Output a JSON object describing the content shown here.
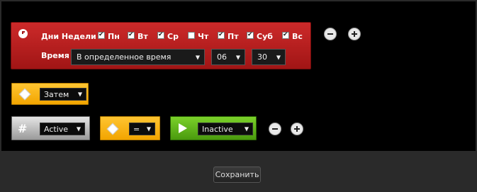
{
  "schedule": {
    "days_label": "Дни Недели",
    "days": [
      {
        "label": "Пн",
        "checked": true
      },
      {
        "label": "Вт",
        "checked": true
      },
      {
        "label": "Ср",
        "checked": true
      },
      {
        "label": "Чт",
        "checked": false
      },
      {
        "label": "Пт",
        "checked": true
      },
      {
        "label": "Суб",
        "checked": true
      },
      {
        "label": "Вс",
        "checked": true
      }
    ],
    "time_label": "Время",
    "time_mode": "В определенное время",
    "hour": "06",
    "minute": "30"
  },
  "then_block": {
    "value": "Затем"
  },
  "condition": {
    "state_value": "Active",
    "operator": "=",
    "target_value": "Inactive"
  },
  "footer": {
    "save_label": "Сохранить"
  },
  "colors": {
    "trigger_red": "#b81c1c",
    "action_orange": "#f5b000",
    "variable_gray": "#bdbdbd",
    "state_green": "#5ab41a"
  }
}
